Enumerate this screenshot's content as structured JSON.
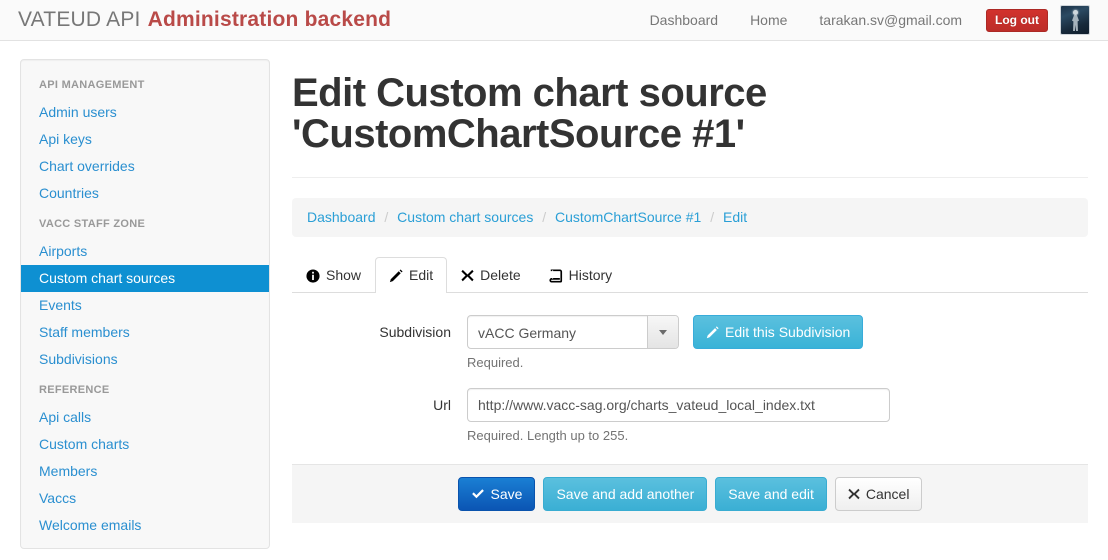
{
  "navbar": {
    "brand_primary": "VATEUD API",
    "brand_secondary": "Administration backend",
    "links": [
      {
        "label": "Dashboard",
        "name": "nav-link-dashboard"
      },
      {
        "label": "Home",
        "name": "nav-link-home"
      },
      {
        "label": "tarakan.sv@gmail.com",
        "name": "nav-link-user-email"
      }
    ],
    "logout_label": "Log out",
    "avatar_alt": "user-avatar"
  },
  "sidebar": {
    "groups": [
      {
        "header": "API MANAGEMENT",
        "items": [
          {
            "label": "Admin users",
            "active": false
          },
          {
            "label": "Api keys",
            "active": false
          },
          {
            "label": "Chart overrides",
            "active": false
          },
          {
            "label": "Countries",
            "active": false
          }
        ]
      },
      {
        "header": "VACC STAFF ZONE",
        "items": [
          {
            "label": "Airports",
            "active": false
          },
          {
            "label": "Custom chart sources",
            "active": true
          },
          {
            "label": "Events",
            "active": false
          },
          {
            "label": "Staff members",
            "active": false
          },
          {
            "label": "Subdivisions",
            "active": false
          }
        ]
      },
      {
        "header": "REFERENCE",
        "items": [
          {
            "label": "Api calls",
            "active": false
          },
          {
            "label": "Custom charts",
            "active": false
          },
          {
            "label": "Members",
            "active": false
          },
          {
            "label": "Vaccs",
            "active": false
          },
          {
            "label": "Welcome emails",
            "active": false
          }
        ]
      }
    ]
  },
  "main": {
    "title_line1": "Edit Custom chart source",
    "title_line2": "'CustomChartSource #1'",
    "breadcrumb": [
      {
        "label": "Dashboard",
        "link": true
      },
      {
        "label": "Custom chart sources",
        "link": true
      },
      {
        "label": "CustomChartSource #1",
        "link": true
      },
      {
        "label": "Edit",
        "link": true
      }
    ],
    "breadcrumb_separator": "/",
    "tabs": [
      {
        "label": "Show",
        "icon": "info-circle-icon",
        "active": false
      },
      {
        "label": "Edit",
        "icon": "pencil-icon",
        "active": true
      },
      {
        "label": "Delete",
        "icon": "times-icon",
        "active": false
      },
      {
        "label": "History",
        "icon": "book-icon",
        "active": false
      }
    ],
    "form": {
      "subdivision": {
        "label": "Subdivision",
        "selected_value": "vACC Germany",
        "options": [
          "vACC Germany"
        ],
        "help": "Required.",
        "edit_button_label": "Edit this Subdivision",
        "edit_button_icon": "pencil-icon"
      },
      "url": {
        "label": "Url",
        "value": "http://www.vacc-sag.org/charts_vateud_local_index.txt",
        "placeholder": "",
        "help": "Required. Length up to 255."
      }
    },
    "footer_buttons": [
      {
        "label": "Save",
        "style": "primary",
        "icon": "check-icon"
      },
      {
        "label": "Save and add another",
        "style": "info",
        "icon": ""
      },
      {
        "label": "Save and edit",
        "style": "info",
        "icon": ""
      },
      {
        "label": "Cancel",
        "style": "default",
        "icon": "times-icon"
      }
    ]
  },
  "colors": {
    "brand_red": "#b94a48",
    "accent_blue": "#0e90d2",
    "link_blue": "#2a9fd6",
    "danger": "#c9302c",
    "info": "#5bc0de",
    "primary": "#1264c0"
  }
}
